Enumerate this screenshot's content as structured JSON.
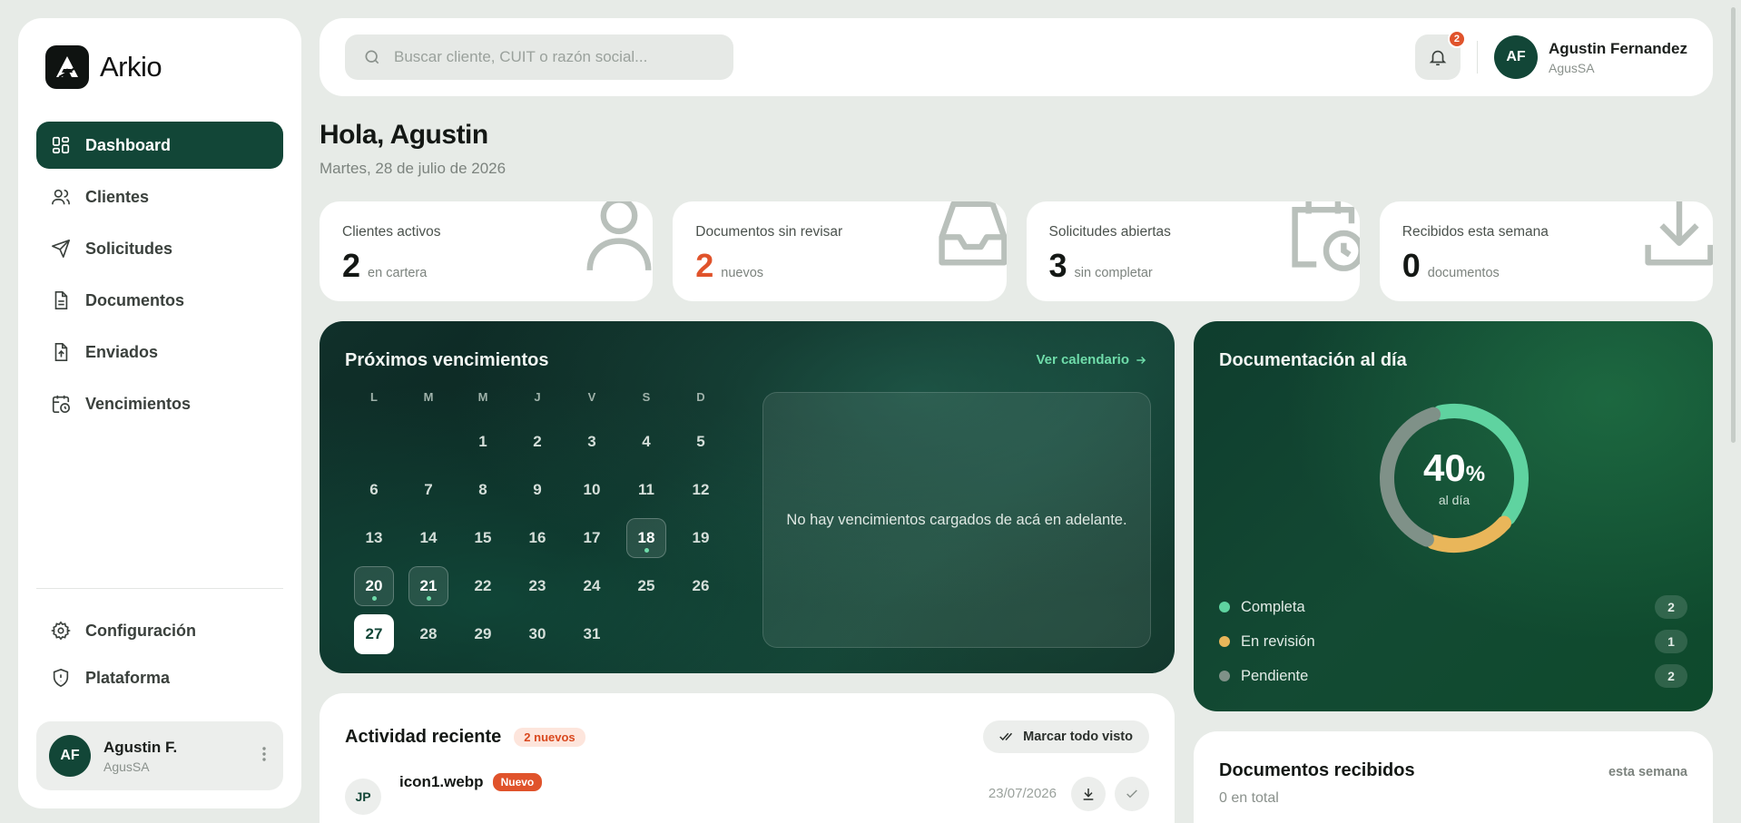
{
  "brand": {
    "name": "Arkio"
  },
  "nav": {
    "items": [
      {
        "label": "Dashboard",
        "icon": "dashboard-icon",
        "active": true
      },
      {
        "label": "Clientes",
        "icon": "users-icon"
      },
      {
        "label": "Solicitudes",
        "icon": "send-icon"
      },
      {
        "label": "Documentos",
        "icon": "document-icon"
      },
      {
        "label": "Enviados",
        "icon": "file-upload-icon"
      },
      {
        "label": "Vencimientos",
        "icon": "calendar-clock-icon"
      }
    ],
    "bottom": [
      {
        "label": "Configuración",
        "icon": "gear-icon"
      },
      {
        "label": "Plataforma",
        "icon": "shield-icon"
      }
    ]
  },
  "sidebar_user": {
    "initials": "AF",
    "name": "Agustin F.",
    "company": "AgusSA"
  },
  "topbar": {
    "search_placeholder": "Buscar cliente, CUIT o razón social...",
    "notifications_count": "2",
    "user_initials": "AF",
    "user_name": "Agustin Fernandez",
    "user_company": "AgusSA"
  },
  "greeting": {
    "title": "Hola, Agustin",
    "date": "Martes, 28 de julio de 2026"
  },
  "stats": [
    {
      "label": "Clientes activos",
      "value": "2",
      "unit": "en cartera",
      "icon": "user-icon"
    },
    {
      "label": "Documentos sin revisar",
      "value": "2",
      "unit": "nuevos",
      "icon": "inbox-icon",
      "accent": true
    },
    {
      "label": "Solicitudes abiertas",
      "value": "3",
      "unit": "sin completar",
      "icon": "calendar-clock-icon"
    },
    {
      "label": "Recibidos esta semana",
      "value": "0",
      "unit": "documentos",
      "icon": "download-icon"
    }
  ],
  "calendar": {
    "title": "Próximos vencimientos",
    "link": "Ver calendario",
    "weekdays": [
      "L",
      "M",
      "M",
      "J",
      "V",
      "S",
      "D"
    ],
    "weeks": [
      [
        "",
        "",
        "1",
        "2",
        "3",
        "4",
        "5"
      ],
      [
        "6",
        "7",
        "8",
        "9",
        "10",
        "11",
        "12"
      ],
      [
        "13",
        "14",
        "15",
        "16",
        "17",
        "18",
        "19"
      ],
      [
        "20",
        "21",
        "22",
        "23",
        "24",
        "25",
        "26"
      ],
      [
        "27",
        "28",
        "29",
        "30",
        "31",
        "",
        ""
      ]
    ],
    "marked_days": [
      "18",
      "20",
      "21"
    ],
    "today": "27",
    "empty_message": "No hay vencimientos cargados de acá en adelante."
  },
  "compliance": {
    "title": "Documentación al día",
    "percent": "40",
    "percent_sign": "%",
    "caption": "al día",
    "colors": {
      "completa": "#5fd3a0",
      "revision": "#e9b65a",
      "pendiente": "#7f9188"
    },
    "legend": [
      {
        "label": "Completa",
        "count": "2",
        "color": "#5fd3a0"
      },
      {
        "label": "En revisión",
        "count": "1",
        "color": "#e9b65a"
      },
      {
        "label": "Pendiente",
        "count": "2",
        "color": "#7f9188"
      }
    ]
  },
  "activity": {
    "title": "Actividad reciente",
    "badge": "2 nuevos",
    "mark_all": "Marcar todo visto",
    "rows": [
      {
        "initials": "JP",
        "file": "icon1.webp",
        "tag": "Nuevo",
        "date": "23/07/2026"
      }
    ]
  },
  "received": {
    "title": "Documentos recibidos",
    "period": "esta semana",
    "total": "0 en total"
  },
  "colors": {
    "primary": "#124637",
    "accent": "#e0532b",
    "link": "#6fdcaa"
  }
}
